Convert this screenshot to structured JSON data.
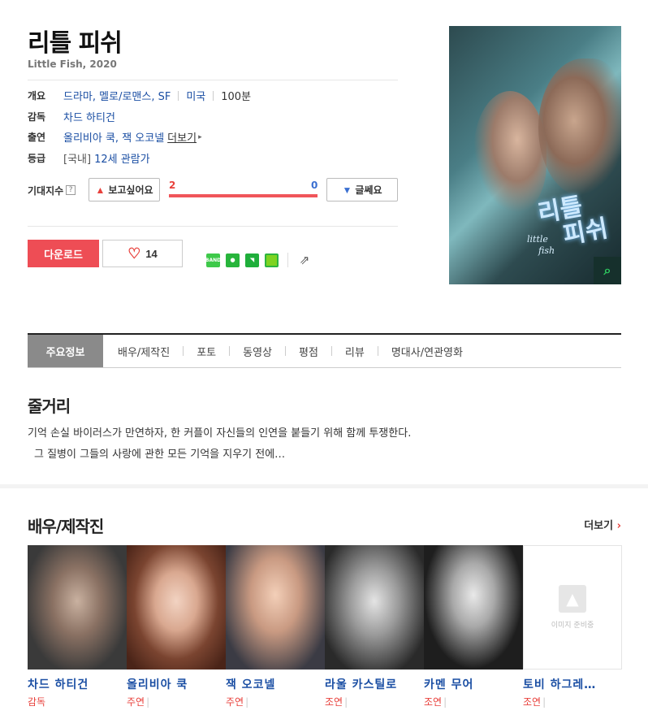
{
  "movie": {
    "title": "리틀 피쉬",
    "subtitle": "Little Fish, 2020"
  },
  "info": {
    "overview_label": "개요",
    "genre": "드라마, 멜로/로맨스, SF",
    "country": "미국",
    "runtime": "100분",
    "director_label": "감독",
    "director": "차드 하티건",
    "cast_label": "출연",
    "cast": "올리비아 쿡, 잭 오코넬",
    "more": "더보기",
    "rating_label": "등급",
    "rating_region": "[국내]",
    "rating": "12세 관람가"
  },
  "expect": {
    "label": "기대지수",
    "q": "?",
    "want_label": "보고싶어요",
    "no_label": "글쎄요",
    "want_count": "2",
    "no_count": "0"
  },
  "actions": {
    "download_label": "다운로드",
    "like_count": "14"
  },
  "share": {
    "band": "BAND"
  },
  "poster": {
    "title_line1": "리틀",
    "title_line2": "피쉬",
    "sub_line1": "little",
    "sub_line2": "fish"
  },
  "tabs": [
    {
      "label": "주요정보"
    },
    {
      "label": "배우/제작진"
    },
    {
      "label": "포토"
    },
    {
      "label": "동영상"
    },
    {
      "label": "평점"
    },
    {
      "label": "리뷰"
    },
    {
      "label": "명대사/연관영화"
    }
  ],
  "plot": {
    "heading": "줄거리",
    "line1": "기억 손실 바이러스가 만연하자, 한 커플이 자신들의 인연을 붙들기 위해 함께 투쟁한다.",
    "line2": "그 질병이 그들의 사랑에 관한 모든 기억을 지우기 전에…"
  },
  "cast_section": {
    "heading": "배우/제작진",
    "more": "더보기",
    "no_image": "이미지 준비중",
    "people": [
      {
        "name": "차드 하티건",
        "role": "감독"
      },
      {
        "name": "올리비아 쿡",
        "role": "주연"
      },
      {
        "name": "잭 오코넬",
        "role": "주연"
      },
      {
        "name": "라울 카스틸로",
        "role": "조연"
      },
      {
        "name": "카멘 무어",
        "role": "조연"
      },
      {
        "name": "토비 하그레…",
        "role": "조연"
      }
    ]
  },
  "colors": {
    "accent": "#ee4d55",
    "link": "#1a4ea3",
    "no_vote": "#3a6fd1"
  }
}
